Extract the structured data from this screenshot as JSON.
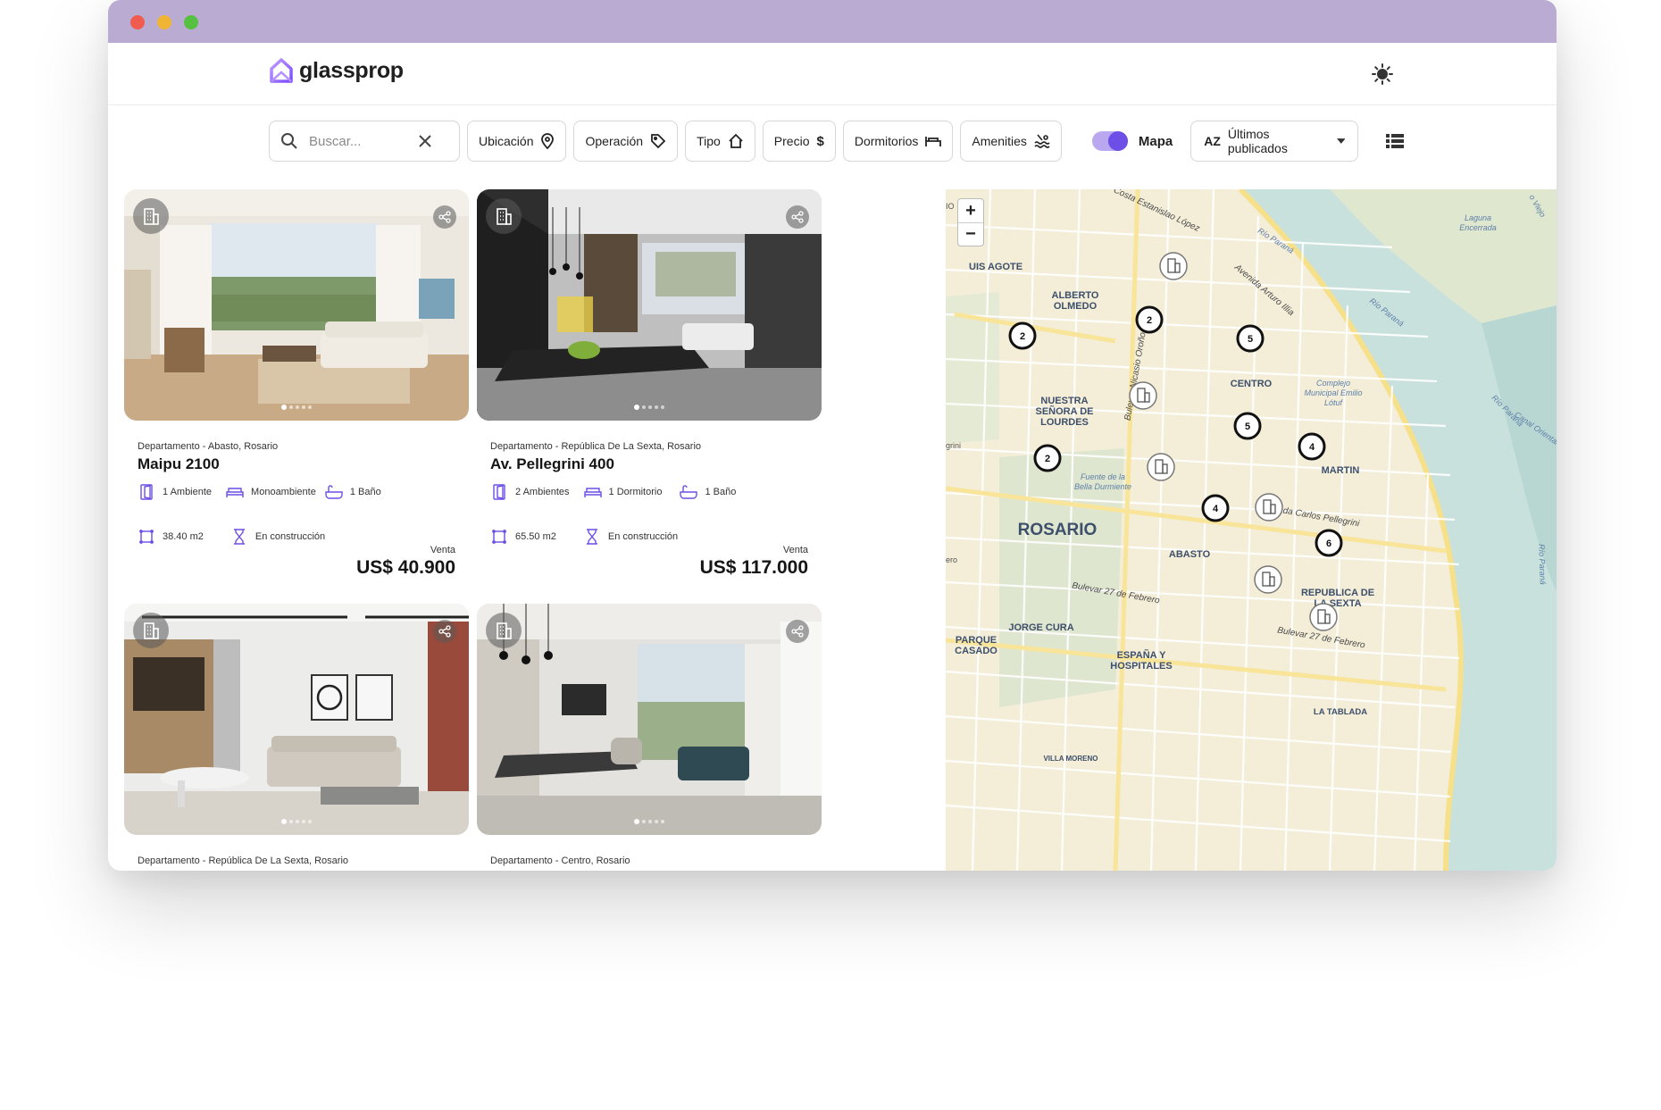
{
  "window": {
    "controls": [
      "close",
      "minimize",
      "maximize"
    ]
  },
  "header": {
    "logo_text": "glassprop",
    "theme_icon": "sun-icon"
  },
  "toolbar": {
    "search_placeholder": "Buscar...",
    "filters": [
      {
        "label": "Ubicación",
        "icon": "location-pin-icon"
      },
      {
        "label": "Operación",
        "icon": "tag-icon"
      },
      {
        "label": "Tipo",
        "icon": "house-icon"
      },
      {
        "label": "Precio",
        "icon": "dollar-icon"
      },
      {
        "label": "Dormitorios",
        "icon": "bed-icon"
      },
      {
        "label": "Amenities",
        "icon": "pool-icon"
      }
    ],
    "map_toggle_label": "Mapa",
    "map_toggle_on": true,
    "sort_label": "Últimos publicados",
    "sort_prefix": "AZ"
  },
  "colors": {
    "accent": "#6d4ee6",
    "titlebar": "#b9abd2"
  },
  "listings": [
    {
      "location": "Departamento - Abasto, Rosario",
      "title": "Maipu 2100",
      "ambientes": "1 Ambiente",
      "dormitorios": "Monoambiente",
      "banos": "1 Baño",
      "superficie": "38.40 m2",
      "estado": "En construcción",
      "operation": "Venta",
      "price": "US$ 40.900"
    },
    {
      "location": "Departamento - República De La Sexta, Rosario",
      "title": "Av. Pellegrini 400",
      "ambientes": "2 Ambientes",
      "dormitorios": "1 Dormitorio",
      "banos": "1 Baño",
      "superficie": "65.50 m2",
      "estado": "En construcción",
      "operation": "Venta",
      "price": "US$ 117.000"
    },
    {
      "location": "Departamento - República De La Sexta, Rosario"
    },
    {
      "location": "Departamento - Centro, Rosario"
    }
  ],
  "map": {
    "zoom_in": "+",
    "zoom_out": "−",
    "labels": {
      "alberto": "ALBERTO",
      "olmedo": "OLMEDO",
      "nuestra": "NUESTRA",
      "senora": "SEÑORA DE",
      "lourdes": "LOURDES",
      "centro": "CENTRO",
      "martin": "MARTIN",
      "rosario": "ROSARIO",
      "abasto": "ABASTO",
      "republica": "REPUBLICA DE",
      "lasexta": "LA SEXTA",
      "jorge": "JORGE CURA",
      "parque": "PARQUE",
      "casado": "CASADO",
      "espana": "ESPAÑA Y",
      "hospitales": "HOSPITALES",
      "tablada": "LA TABLADA",
      "agote": "UIS AGOTE",
      "fuente1": "Fuente de la",
      "fuente2": "Bella Durmiente",
      "complejo1": "Complejo",
      "complejo2": "Municipal Emilio",
      "complejo3": "Lótuf",
      "laguna1": "Laguna",
      "laguna2": "Encerrada",
      "rioparana1": "Río Paraná",
      "rioparana2": "Río Paraná",
      "rioparana3": "Río Paraná",
      "rioparana4": "Río Paraná",
      "canal": "Canal Oriental",
      "costanera": "Costa Estanislao López",
      "avarturo": "Avenida Arturo Illia",
      "bvnicasio": "Bulevar Nicasio Oroño",
      "bv27a": "Bulevar 27 de Febrero",
      "bv27b": "Bulevar 27 de Febrero",
      "pellegrini": "da Carlos Pellegrini",
      "villamoreno": "VILLA MORENO",
      "grini": "grini",
      "ero": "ero",
      "io": "IO",
      "viejo": "o Viejo"
    },
    "clusters": [
      {
        "count": "2"
      },
      {
        "count": "2"
      },
      {
        "count": "5"
      },
      {
        "count": "5"
      },
      {
        "count": "4"
      },
      {
        "count": "2"
      },
      {
        "count": "4"
      },
      {
        "count": "6"
      }
    ],
    "single_markers": 6
  }
}
